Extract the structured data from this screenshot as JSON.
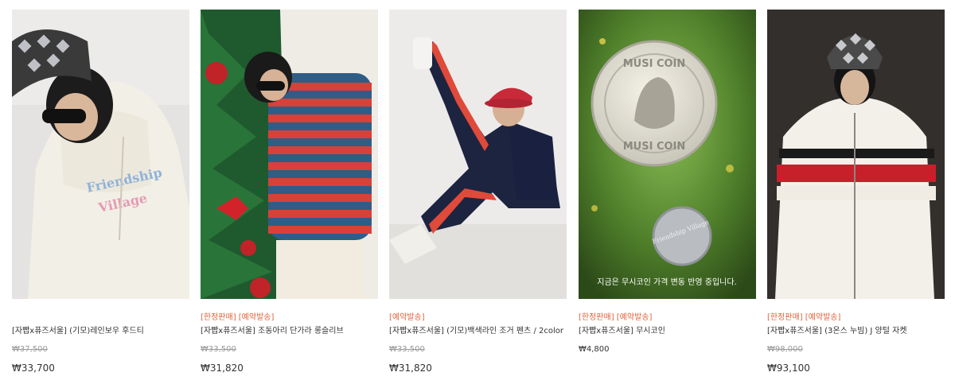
{
  "products": [
    {
      "badges": "",
      "name": "[자빱x퓨즈서울] (기모)레인보우 후드티",
      "original_price": "₩37,500",
      "price": "₩33,700"
    },
    {
      "badges": "[한정판매] [예약발송]",
      "name": "[자빱x퓨즈서울] 조동아리 단가라 롱슬리브",
      "original_price": "₩33,500",
      "price": "₩31,820"
    },
    {
      "badges": "[예약발송]",
      "name": "[자빱x퓨즈서울] (기모)백색라인 조거 펜츠 / 2color",
      "original_price": "₩33,500",
      "price": "₩31,820"
    },
    {
      "badges": "[한정판매] [예약발송]",
      "name": "[자빱x퓨즈서울] 무시코인",
      "original_price": "₩4,800",
      "price": "",
      "coin_caption": "지금은 무시코인 가격 변동 반영 중입니다.",
      "coin_text": "MUSI COIN",
      "coin_small_text": "Friendship Village"
    },
    {
      "badges": "[한정판매] [예약발송]",
      "name": "[자빱x퓨즈서울] (3온스 누빔) J 양털 자켓",
      "original_price": "₩98,000",
      "price": "₩93,100"
    }
  ]
}
